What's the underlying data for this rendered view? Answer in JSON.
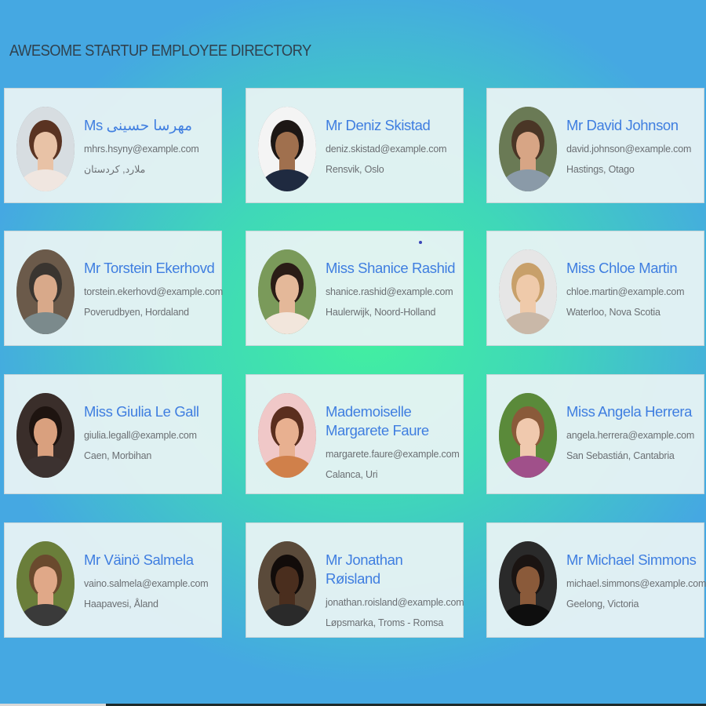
{
  "page": {
    "title": "AWESOME STARTUP EMPLOYEE DIRECTORY"
  },
  "colors": {
    "name": "#3f7ee0",
    "text": "#6b6f73",
    "card": "#e9f3f4",
    "gradient_center": "#42f0a0",
    "gradient_edge": "#45a8e2"
  },
  "employees": [
    {
      "name": "Ms مهرسا حسینی",
      "email": "mhrs.hsyny@example.com",
      "location": "ملارد, کردستان",
      "avatar": "avatar-photo",
      "photo": {
        "bg": "#d7dde1",
        "skin": "#e8c2a6",
        "hair": "#5a3322",
        "shirt": "#f0e6e0"
      }
    },
    {
      "name": "Mr Deniz Skistad",
      "email": "deniz.skistad@example.com",
      "location": "Rensvik, Oslo",
      "avatar": "avatar-photo",
      "photo": {
        "bg": "#f4f4f4",
        "skin": "#a0704e",
        "hair": "#1d1715",
        "shirt": "#1f2a40"
      }
    },
    {
      "name": "Mr David Johnson",
      "email": "david.johnson@example.com",
      "location": "Hastings, Otago",
      "avatar": "avatar-photo",
      "photo": {
        "bg": "#6a7a55",
        "skin": "#d7a585",
        "hair": "#4a3626",
        "shirt": "#8a9aa8"
      }
    },
    {
      "name": "Mr Torstein Ekerhovd",
      "email": "torstein.ekerhovd@example.com",
      "location": "Poverudbyen, Hordaland",
      "avatar": "avatar-photo",
      "photo": {
        "bg": "#6b5a4a",
        "skin": "#d8a98a",
        "hair": "#3a3530",
        "shirt": "#7b8a8c"
      }
    },
    {
      "name": "Miss Shanice Rashid",
      "email": "shanice.rashid@example.com",
      "location": "Haulerwijk, Noord-Holland",
      "avatar": "avatar-photo",
      "photo": {
        "bg": "#7a9a5a",
        "skin": "#e4b899",
        "hair": "#2a1c16",
        "shirt": "#f2e6dc"
      }
    },
    {
      "name": "Miss Chloe Martin",
      "email": "chloe.martin@example.com",
      "location": "Waterloo, Nova Scotia",
      "avatar": "avatar-photo",
      "photo": {
        "bg": "#e6e6e6",
        "skin": "#efcaaa",
        "hair": "#c8a06a",
        "shirt": "#c9b8a8"
      }
    },
    {
      "name": "Miss Giulia Le Gall",
      "email": "giulia.legall@example.com",
      "location": "Caen, Morbihan",
      "avatar": "avatar-photo",
      "photo": {
        "bg": "#3a2e2a",
        "skin": "#d9a07e",
        "hair": "#1e1410",
        "shirt": "#3c3230"
      }
    },
    {
      "name": "Mademoiselle Margarete Faure",
      "email": "margarete.faure@example.com",
      "location": "Calanca, Uri",
      "avatar": "avatar-photo",
      "photo": {
        "bg": "#f0c8c8",
        "skin": "#e8b090",
        "hair": "#5a2e1e",
        "shirt": "#d0804a"
      }
    },
    {
      "name": "Miss Angela Herrera",
      "email": "angela.herrera@example.com",
      "location": "San Sebastián, Cantabria",
      "avatar": "avatar-photo",
      "photo": {
        "bg": "#5a8a3a",
        "skin": "#f0c9ae",
        "hair": "#8a5a3a",
        "shirt": "#a0508a"
      }
    },
    {
      "name": "Mr Väinö Salmela",
      "email": "vaino.salmela@example.com",
      "location": "Haapavesi, Åland",
      "avatar": "avatar-photo",
      "photo": {
        "bg": "#6a7e3a",
        "skin": "#e0a888",
        "hair": "#6a4a2e",
        "shirt": "#3a3a3a"
      }
    },
    {
      "name": "Mr Jonathan Røisland",
      "email": "jonathan.roisland@example.com",
      "location": "Løpsmarka, Troms - Romsa",
      "avatar": "avatar-photo",
      "photo": {
        "bg": "#5a4a3a",
        "skin": "#4a2e1e",
        "hair": "#120c0a",
        "shirt": "#2a2a2a"
      }
    },
    {
      "name": "Mr Michael Simmons",
      "email": "michael.simmons@example.com",
      "location": "Geelong, Victoria",
      "avatar": "avatar-photo",
      "photo": {
        "bg": "#2a2a2a",
        "skin": "#8a5a3a",
        "hair": "#1a1412",
        "shirt": "#0e0e0e"
      }
    }
  ]
}
